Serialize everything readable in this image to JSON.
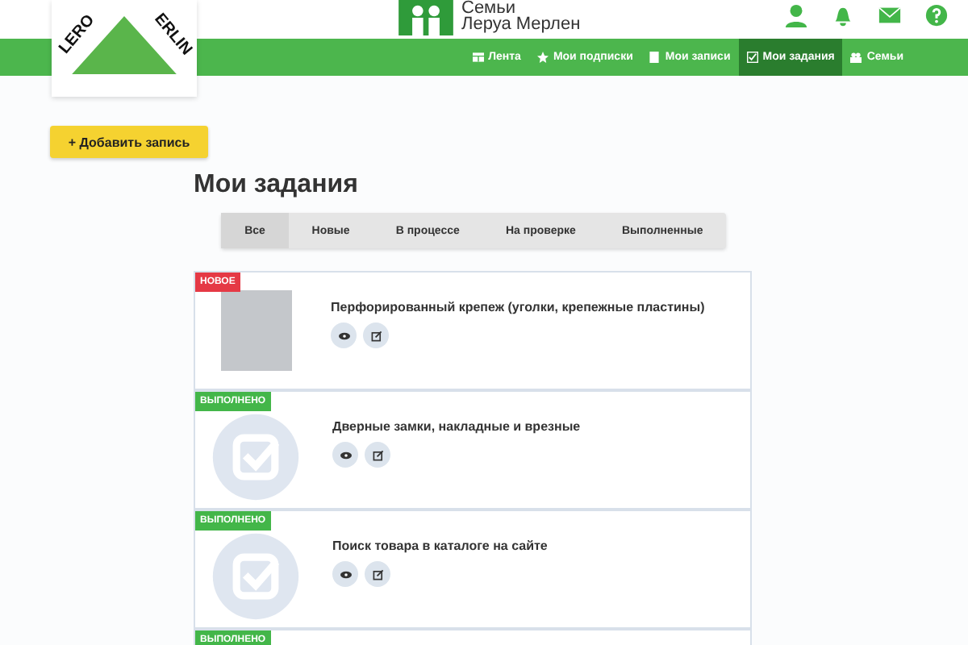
{
  "logo": {
    "left": "LERO",
    "right": "ERLIN"
  },
  "site_title": [
    "Семьи",
    "Леруа Мерлен"
  ],
  "nav": [
    {
      "label": "Лента",
      "selected": false
    },
    {
      "label": "Мои подписки",
      "selected": false
    },
    {
      "label": "Мои записи",
      "selected": false
    },
    {
      "label": "Мои задания",
      "selected": true
    },
    {
      "label": "Семьи",
      "selected": false
    }
  ],
  "add_button": {
    "icon": "+",
    "label": "Добавить запись"
  },
  "page_title": "Мои задания",
  "tabs": [
    {
      "label": "Все",
      "selected": true
    },
    {
      "label": "Новые",
      "selected": false
    },
    {
      "label": "В процессе",
      "selected": false
    },
    {
      "label": "На проверке",
      "selected": false
    },
    {
      "label": "Выполненные",
      "selected": false
    }
  ],
  "tasks": [
    {
      "status": "НОВОЕ",
      "kind": "new",
      "title": "Перфорированный крепеж (уголки, крепежные пластины)"
    },
    {
      "status": "ВЫПОЛНЕНО",
      "kind": "done",
      "title": "Дверные замки, накладные и врезные"
    },
    {
      "status": "ВЫПОЛНЕНО",
      "kind": "done",
      "title": "Поиск товара в каталоге на сайте"
    },
    {
      "status": "ВЫПОЛНЕНО",
      "kind": "done"
    }
  ]
}
